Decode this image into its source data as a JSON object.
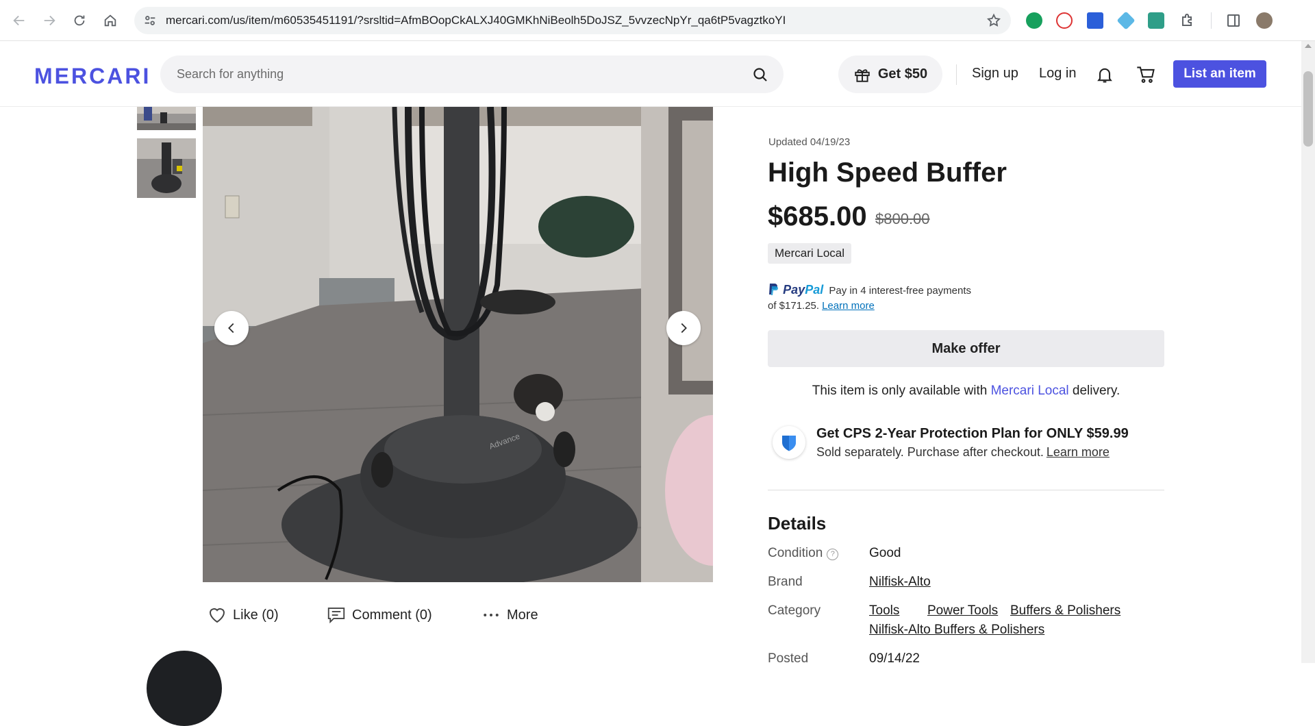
{
  "browser": {
    "url": "mercari.com/us/item/m60535451191/?srsltid=AfmBOopCkALXJ40GMKhNiBeolh5DoJSZ_5vvzecNpYr_qa6tP5vagztkoYI"
  },
  "header": {
    "logo": "MERCARI",
    "search_placeholder": "Search for anything",
    "get50": "Get $50",
    "sign_up": "Sign up",
    "log_in": "Log in",
    "list_item": "List an item"
  },
  "gallery": {
    "like": "Like (0)",
    "comment": "Comment (0)",
    "more": "More"
  },
  "item": {
    "updated": "Updated 04/19/23",
    "title": "High Speed Buffer",
    "price": "$685.00",
    "original_price": "$800.00",
    "badge": "Mercari Local",
    "paypal_text": "Pay in 4 interest-free payments",
    "paypal_amount": "of $171.25.",
    "paypal_learn": "Learn more",
    "make_offer": "Make offer",
    "local_note_pre": "This item is only available with",
    "local_note_link": "Mercari Local",
    "local_note_post": "delivery.",
    "cps_title": "Get CPS 2-Year Protection Plan for ONLY $59.99",
    "cps_sub": "Sold separately. Purchase after checkout.",
    "cps_learn": "Learn more"
  },
  "details": {
    "heading": "Details",
    "condition_label": "Condition",
    "condition_value": "Good",
    "brand_label": "Brand",
    "brand_value": "Nilfisk-Alto",
    "category_label": "Category",
    "categories": [
      "Tools",
      "Power Tools",
      "Buffers & Polishers",
      "Nilfisk-Alto Buffers & Polishers"
    ],
    "posted_label": "Posted",
    "posted_value": "09/14/22"
  },
  "colors": {
    "brand": "#4c52e0",
    "paypal_dark": "#253b80",
    "paypal_light": "#179bd7"
  }
}
